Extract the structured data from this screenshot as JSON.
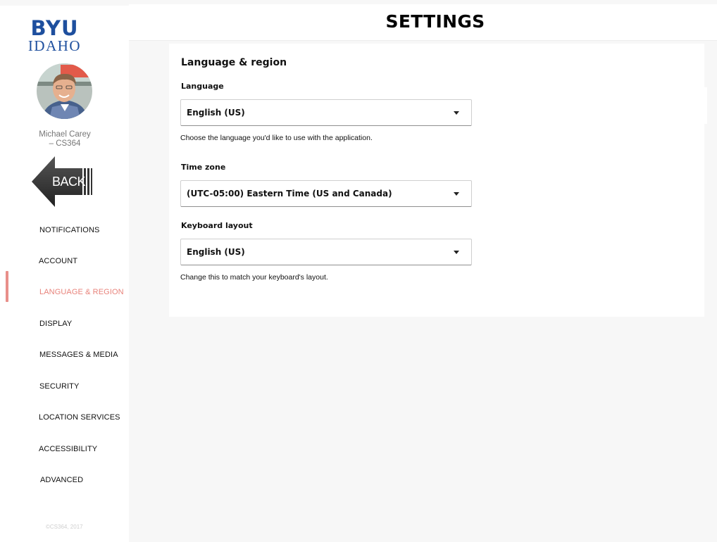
{
  "brand": {
    "line1": "BYU",
    "line2": "IDAHO",
    "color": "#1e4f9e"
  },
  "user": {
    "name": "Michael Carey",
    "course": "– CS364"
  },
  "back_label": "BACK",
  "accent_color": "#e8837b",
  "sidebar": {
    "items": [
      {
        "label": "NOTIFICATIONS",
        "active": false
      },
      {
        "label": "ACCOUNT",
        "active": false
      },
      {
        "label": "LANGUAGE & REGION",
        "active": true
      },
      {
        "label": "DISPLAY",
        "active": false
      },
      {
        "label": "MESSAGES & MEDIA",
        "active": false
      },
      {
        "label": "SECURITY",
        "active": false
      },
      {
        "label": "LOCATION SERVICES",
        "active": false
      },
      {
        "label": "ACCESSIBILITY",
        "active": false
      },
      {
        "label": "ADVANCED",
        "active": false
      }
    ],
    "footer": "©CS364, 2017"
  },
  "header": {
    "title": "SETTINGS"
  },
  "main": {
    "section_title": "Language & region",
    "language": {
      "label": "Language",
      "value": "English (US)",
      "help": "Choose the language you'd like to use with the application."
    },
    "timezone": {
      "label": "Time zone",
      "value": "(UTC-05:00) Eastern Time (US and Canada)"
    },
    "keyboard": {
      "label": "Keyboard layout",
      "value": "English (US)",
      "help": "Change this to match your keyboard's layout."
    }
  }
}
